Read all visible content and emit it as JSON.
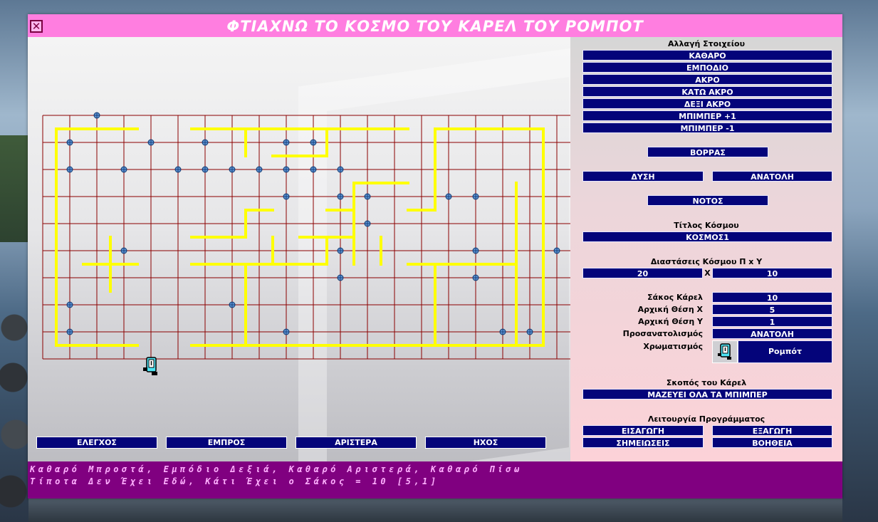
{
  "window": {
    "title": "ΦΤΙΑΧΝΩ ΤΟ ΚΟΣΜΟ ΤΟΥ ΚΑΡΕΛ ΤΟΥ ΡΟΜΠΟΤ",
    "close_label": "✕"
  },
  "colors": {
    "title_bar": "#ff7ee0",
    "button": "#04047a",
    "wall": "#ffff00",
    "grid": "#8b0000",
    "status_bar": "#800080",
    "status_text": "#ffb0ff"
  },
  "panel": {
    "element_change_title": "Αλλαγή Στοιχείου",
    "element_buttons": [
      "ΚΑΘΑΡΟ",
      "ΕΜΠΟΔΙΟ",
      "ΑΚΡΟ",
      "ΚΑΤΩ ΑΚΡΟ",
      "ΔΕΞΙ ΑΚΡΟ",
      "ΜΠΙΜΠΕΡ +1",
      "ΜΠΙΜΠΕΡ -1"
    ],
    "directions": {
      "north": "ΒΟΡΡΑΣ",
      "west": "ΔΥΣΗ",
      "east": "ΑΝΑΤΟΛΗ",
      "south": "ΝΟΤΟΣ"
    },
    "world_title_label": "Τίτλος Κόσμου",
    "world_title_value": "ΚΟΣΜΟΣ1",
    "dimensions_label": "Διαστάσεις Κόσμου Π x Υ",
    "dim_width": "20",
    "dim_sep": "X",
    "dim_height": "10",
    "karel_bag_label": "Σάκος Κάρελ",
    "karel_bag_value": "10",
    "start_x_label": "Αρχική Θέση Χ",
    "start_x_value": "5",
    "start_y_label": "Αρχική Θέση Υ",
    "start_y_value": "1",
    "orientation_label": "Προσανατολισμός",
    "orientation_value": "ΑΝΑΤΟΛΗ",
    "coloring_label": "Χρωματισμός",
    "coloring_value": "Ρομπότ",
    "goal_label": "Σκοπός του Κάρελ",
    "goal_value": "ΜΑΖΕΥΕΙ ΟΛΑ ΤΑ ΜΠΙΜΠΕΡ",
    "program_label": "Λειτουργία Προγράμματος",
    "program_buttons": [
      "ΕΙΣΑΓΩΓΗ",
      "ΕΞΑΓΩΓΗ",
      "ΣΗΜΕΙΩΣΕΙΣ",
      "ΒΟΗΘΕΙΑ"
    ]
  },
  "bottom_buttons": [
    "ΕΛΕΓΧΟΣ",
    "ΕΜΠΡΟΣ",
    "ΑΡΙΣΤΕΡΑ",
    "ΗΧΟΣ"
  ],
  "status": {
    "line1": "Καθαρό Μπροστά, Εμπόδιο Δεξιά, Καθαρό Αριστερά, Καθαρό Πίσω",
    "line2": "Τίποτα Δεν Έχει Εδώ, Κάτι Έχει ο Σάκος = 10 [5,1]"
  },
  "world": {
    "columns": 19,
    "rows": 9,
    "robot": {
      "x": 4,
      "y": 1,
      "direction": "east",
      "icon": "robot-icon"
    },
    "beepers": [
      [
        1,
        8
      ],
      [
        2,
        9
      ],
      [
        3,
        7
      ],
      [
        8,
        7
      ],
      [
        9,
        8
      ],
      [
        4,
        8
      ],
      [
        6,
        8
      ],
      [
        1,
        7
      ],
      [
        5,
        7
      ],
      [
        6,
        7
      ],
      [
        7,
        7
      ],
      [
        9,
        7
      ],
      [
        10,
        7
      ],
      [
        11,
        7
      ],
      [
        10,
        8
      ],
      [
        9,
        6
      ],
      [
        11,
        6
      ],
      [
        12,
        6
      ],
      [
        15,
        6
      ],
      [
        16,
        6
      ],
      [
        12,
        5
      ],
      [
        3,
        4
      ],
      [
        11,
        4
      ],
      [
        16,
        4
      ],
      [
        19,
        4
      ],
      [
        11,
        3
      ],
      [
        16,
        3
      ],
      [
        1,
        2
      ],
      [
        7,
        2
      ],
      [
        1,
        1
      ],
      [
        9,
        1
      ],
      [
        17,
        1
      ],
      [
        18,
        1
      ]
    ],
    "walls": [
      [
        [
          1,
          9
        ],
        [
          4,
          9
        ]
      ],
      [
        [
          6,
          9
        ],
        [
          14,
          9
        ]
      ],
      [
        [
          8,
          9
        ],
        [
          8,
          8
        ]
      ],
      [
        [
          9,
          8
        ],
        [
          11,
          8
        ]
      ],
      [
        [
          11,
          9
        ],
        [
          11,
          8
        ]
      ],
      [
        [
          15,
          9
        ],
        [
          19,
          9
        ]
      ],
      [
        [
          19,
          9
        ],
        [
          19,
          1
        ]
      ],
      [
        [
          15,
          9
        ],
        [
          15,
          6
        ]
      ],
      [
        [
          1,
          9
        ],
        [
          1,
          1
        ]
      ],
      [
        [
          1,
          1
        ],
        [
          4,
          1
        ]
      ],
      [
        [
          6,
          1
        ],
        [
          19,
          1
        ]
      ],
      [
        [
          8,
          6
        ],
        [
          9,
          6
        ]
      ],
      [
        [
          8,
          6
        ],
        [
          8,
          5
        ]
      ],
      [
        [
          6,
          5
        ],
        [
          8,
          5
        ]
      ],
      [
        [
          12,
          7
        ],
        [
          14,
          7
        ]
      ],
      [
        [
          12,
          7
        ],
        [
          12,
          5
        ]
      ],
      [
        [
          10,
          5
        ],
        [
          12,
          5
        ]
      ],
      [
        [
          11,
          6
        ],
        [
          12,
          6
        ]
      ],
      [
        [
          12,
          5
        ],
        [
          12,
          4
        ]
      ],
      [
        [
          9,
          4
        ],
        [
          11,
          4
        ]
      ],
      [
        [
          9,
          5
        ],
        [
          9,
          4
        ]
      ],
      [
        [
          11,
          5
        ],
        [
          11,
          4
        ]
      ],
      [
        [
          14,
          6
        ],
        [
          15,
          6
        ]
      ],
      [
        [
          6,
          4
        ],
        [
          9,
          4
        ]
      ],
      [
        [
          8,
          4
        ],
        [
          8,
          1
        ]
      ],
      [
        [
          2,
          4
        ],
        [
          4,
          4
        ]
      ],
      [
        [
          3,
          5
        ],
        [
          3,
          3
        ]
      ],
      [
        [
          14,
          4
        ],
        [
          18,
          4
        ]
      ],
      [
        [
          15,
          4
        ],
        [
          15,
          1
        ]
      ],
      [
        [
          18,
          4
        ],
        [
          18,
          1
        ]
      ],
      [
        [
          13,
          5
        ],
        [
          13,
          4
        ]
      ],
      [
        [
          18,
          7
        ],
        [
          18,
          2
        ]
      ]
    ]
  }
}
